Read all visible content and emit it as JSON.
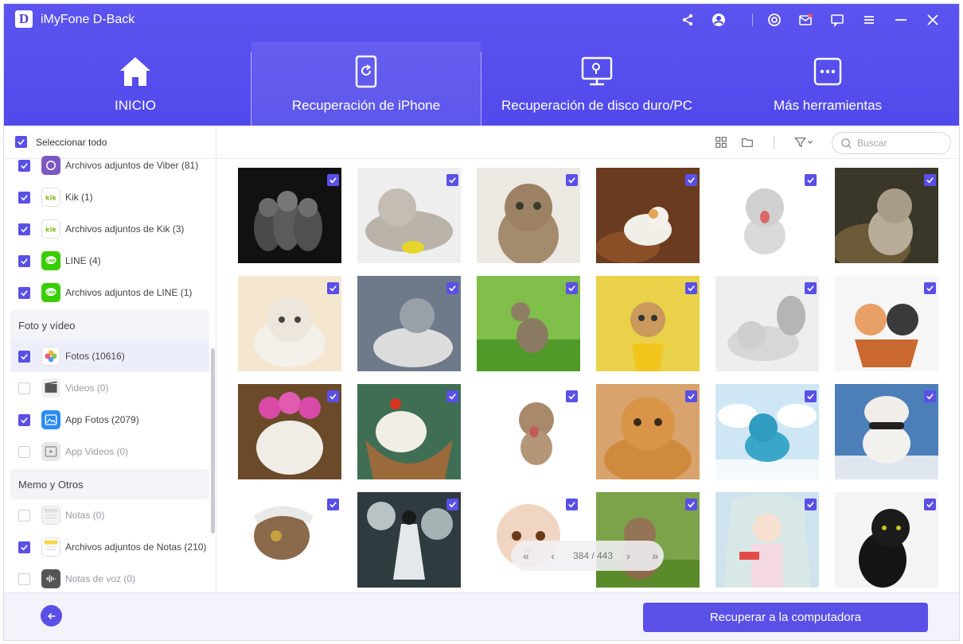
{
  "app": {
    "title": "iMyFone D-Back",
    "logo_letter": "D"
  },
  "header_icons": [
    "share-icon",
    "account-icon",
    "settings-icon",
    "mail-icon",
    "feedback-icon",
    "menu-icon",
    "minimize-icon",
    "close-icon"
  ],
  "tabs": [
    {
      "label": "INICIO",
      "icon": "home-icon"
    },
    {
      "label": "Recuperación de iPhone",
      "icon": "iphone-recovery-icon",
      "active": true
    },
    {
      "label": "Recuperación de disco duro/PC",
      "icon": "pc-recovery-icon"
    },
    {
      "label": "Más herramientas",
      "icon": "more-tools-icon"
    }
  ],
  "sidebar": {
    "select_all": "Seleccionar todo",
    "items": [
      {
        "label": "Archivos adjuntos de Viber (81)",
        "checked": true,
        "icon": "viber-icon"
      },
      {
        "label": "Kik (1)",
        "checked": true,
        "icon": "kik-icon"
      },
      {
        "label": "Archivos adjuntos de Kik (3)",
        "checked": true,
        "icon": "kik-icon"
      },
      {
        "label": "LINE (4)",
        "checked": true,
        "icon": "line-icon"
      },
      {
        "label": "Archivos adjuntos de LINE  (1)",
        "checked": true,
        "icon": "line-icon"
      }
    ],
    "section_photo": "Foto y vídeo",
    "photo_items": [
      {
        "label": "Fotos (10616)",
        "checked": true,
        "icon": "photos-icon",
        "selected": true
      },
      {
        "label": "Videos (0)",
        "checked": false,
        "icon": "videos-icon"
      },
      {
        "label": "App Fotos (2079)",
        "checked": true,
        "icon": "app-photos-icon"
      },
      {
        "label": "App Videos (0)",
        "checked": false,
        "icon": "app-videos-icon"
      }
    ],
    "section_memo": "Memo y Otros",
    "memo_items": [
      {
        "label": "Notas (0)",
        "checked": false,
        "icon": "notes-icon"
      },
      {
        "label": "Archivos adjuntos de Notas (210)",
        "checked": true,
        "icon": "notes-icon"
      },
      {
        "label": "Notas de voz (0)",
        "checked": false,
        "icon": "voice-notes-icon"
      }
    ]
  },
  "toolbar": {
    "search_placeholder": "Buscar"
  },
  "colors": {
    "accent": "#5a4fe6",
    "header": "#5149ea"
  },
  "grid": {
    "columns": 6,
    "rows": 4,
    "all_checked": true
  },
  "pager": {
    "current": "384",
    "separator": "/",
    "total": "443",
    "text": "384 / 443"
  },
  "footer": {
    "recover_label": "Recuperar a la computadora"
  }
}
